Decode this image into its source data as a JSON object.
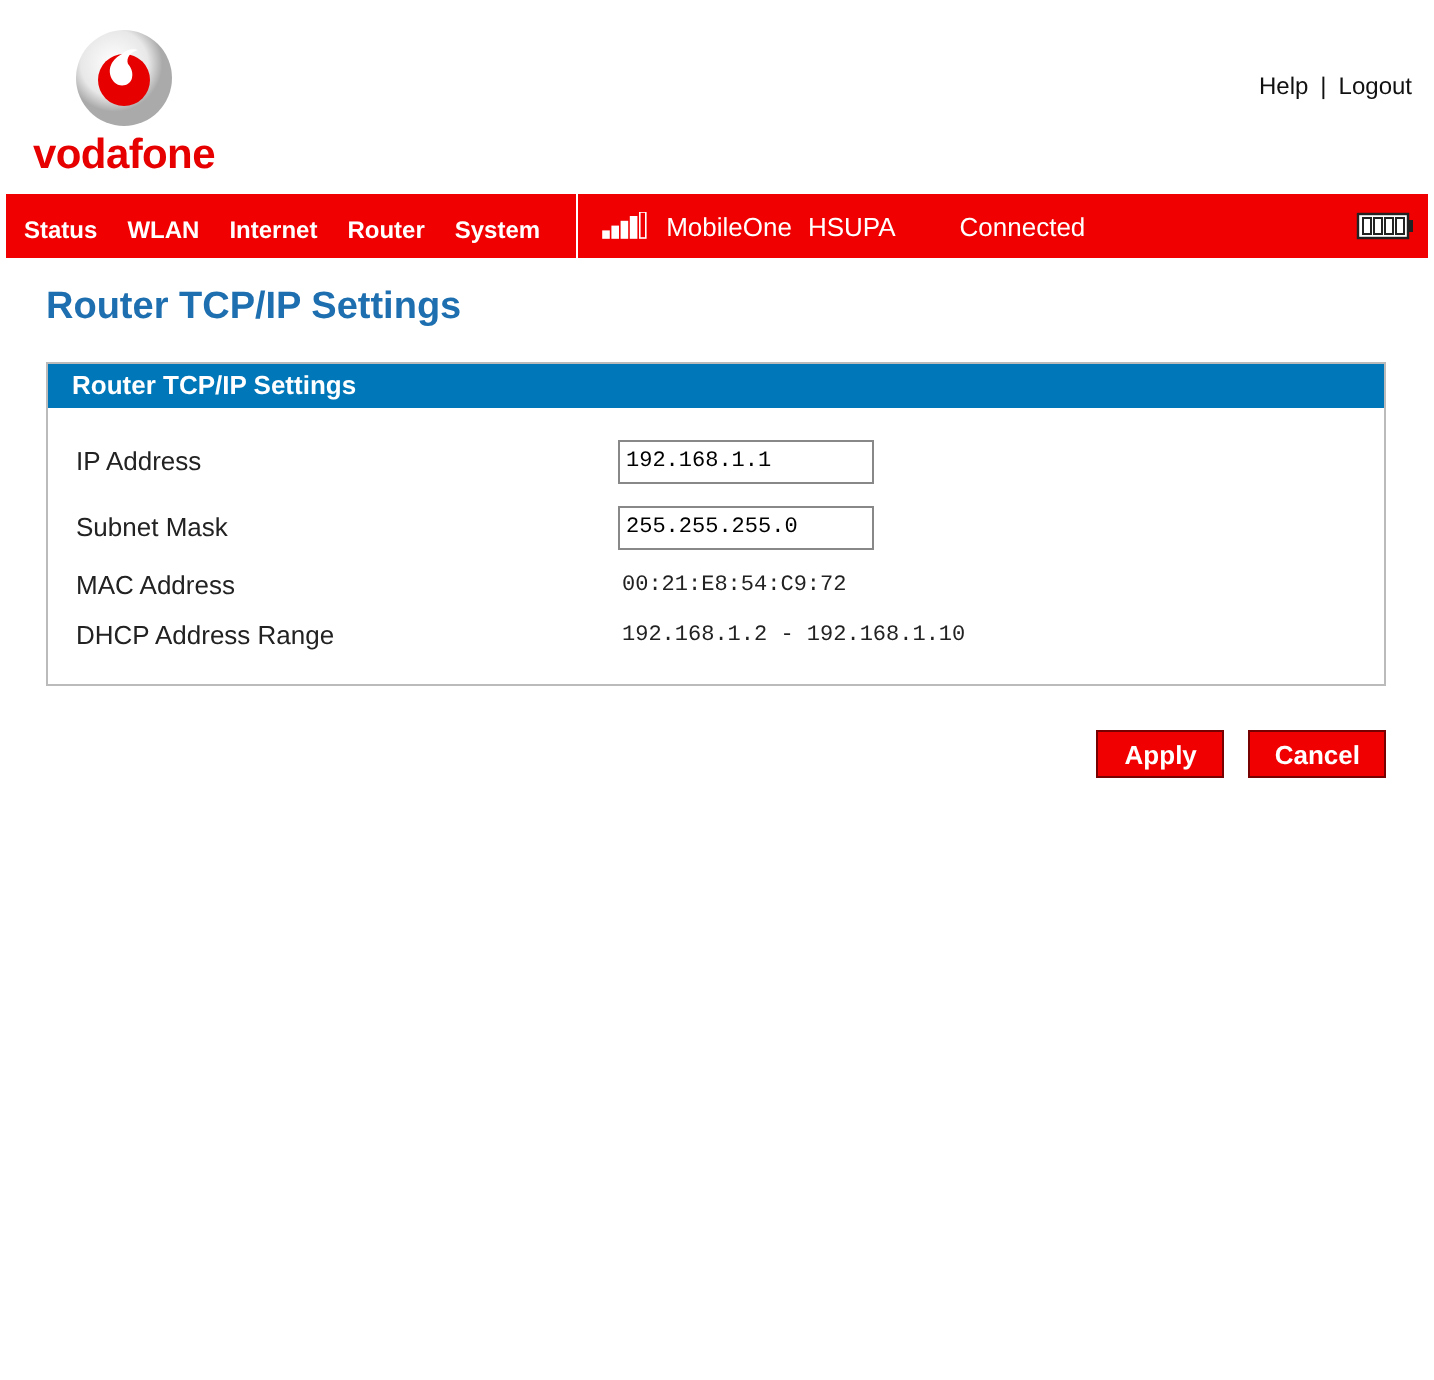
{
  "header": {
    "logo": "vodafone",
    "links": [
      "Help",
      "Logout"
    ],
    "link_separator": "|"
  },
  "nav": {
    "items": [
      "Status",
      "WLAN",
      "Internet",
      "Router",
      "System"
    ],
    "network": "MobileOne",
    "technology": "HSUPA",
    "status": "Connected"
  },
  "page_title": "Router TCP/IP Settings",
  "panel": {
    "title": "Router TCP/IP Settings",
    "rows": [
      {
        "label": "IP Address",
        "kind": "input",
        "value": "192.168.1.1"
      },
      {
        "label": "Subnet Mask",
        "kind": "input",
        "value": "255.255.255.0"
      },
      {
        "label": "MAC Address",
        "kind": "text",
        "value": "00:21:E8:54:C9:72"
      },
      {
        "label": "DHCP Address Range",
        "kind": "text",
        "value": "192.168.1.2 - 192.168.1.10"
      }
    ]
  },
  "buttons": [
    "Apply",
    "Cancel"
  ]
}
